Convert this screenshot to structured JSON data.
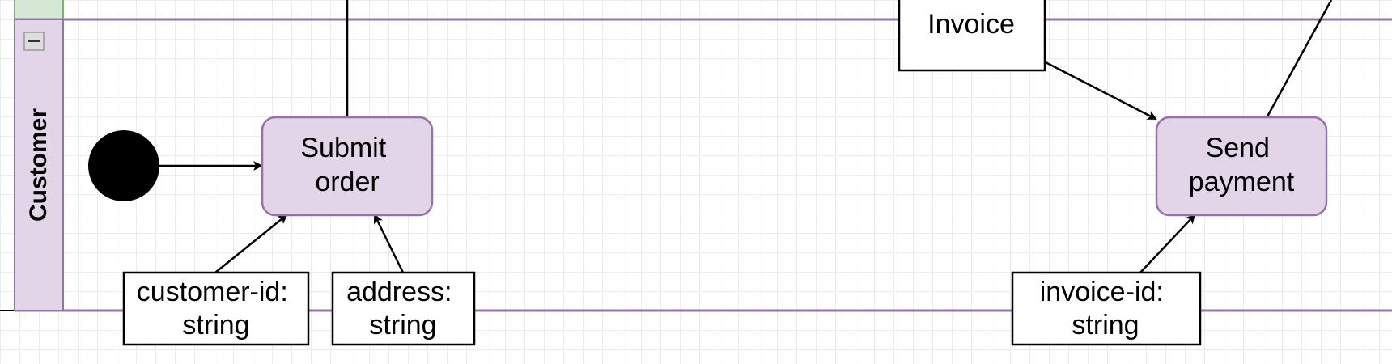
{
  "colors": {
    "lane_fill": "#e1d5e7",
    "lane_stroke": "#9673a6",
    "upper_lane_fill": "#d5e8d4",
    "upper_lane_stroke": "#82b366",
    "box_stroke": "#000000",
    "start_fill": "#000000",
    "grid": "#ececec"
  },
  "lane": {
    "title": "Customer",
    "collapse_icon": "minus-icon"
  },
  "start_event": {
    "icon": "filled-circle"
  },
  "tasks": {
    "submit_order": {
      "line1": "Submit",
      "line2": "order"
    },
    "send_payment": {
      "line1": "Send",
      "line2": "payment"
    }
  },
  "data_objects": {
    "invoice": {
      "label": "Invoice"
    },
    "customer_id": {
      "line1": "customer-id:",
      "line2": "string"
    },
    "address": {
      "line1": "address:",
      "line2": "string"
    },
    "invoice_id": {
      "line1": "invoice-id:",
      "line2": "string"
    }
  }
}
